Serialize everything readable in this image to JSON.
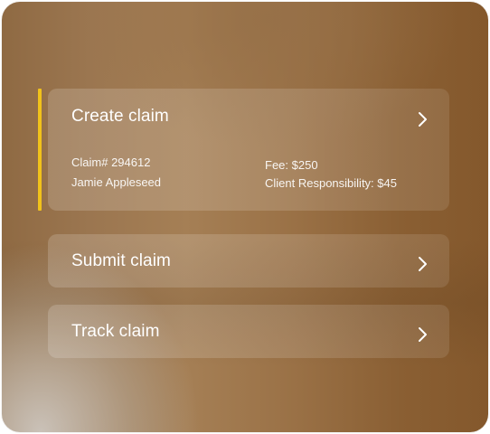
{
  "claims_menu": {
    "create": {
      "title": "Create claim",
      "claim_number": "Claim# 294612",
      "client_name": "Jamie Appleseed",
      "fee": "Fee: $250",
      "client_responsibility": "Client Responsibility: $45",
      "accent_color": "#f1c21b",
      "icon": "chevron-right-icon"
    },
    "submit": {
      "title": "Submit claim",
      "icon": "chevron-right-icon"
    },
    "track": {
      "title": "Track claim",
      "icon": "chevron-right-icon"
    }
  }
}
